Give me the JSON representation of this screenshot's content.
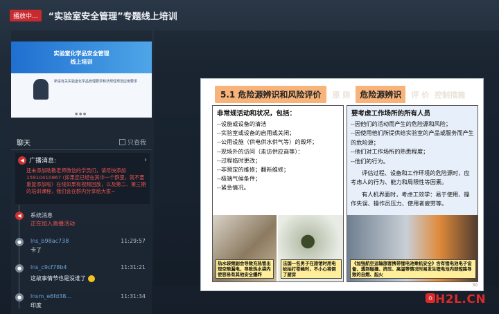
{
  "topbar": {
    "live_badge": "播放中...",
    "title": "“实验室安全管理”专题线上培训"
  },
  "preview": {
    "heading_line1": "实验室化学品安全管理",
    "heading_line2": "线上培训",
    "body_text": "新进有关实验室化学品管理要求和法规性规范应用要求"
  },
  "chat": {
    "title": "聊天",
    "only_view_label": "只查我",
    "broadcast": {
      "title": "广播消息:",
      "text": "还未添加助教老师微信的学员们，请尽快添加15910410867 (如果您已经在其中一个群里，就不要重复添加啦）在线如果有视频回放，以及第二、第三期的培训课程，我们会在群内分享给大家~"
    },
    "messages": [
      {
        "name": "系统消息",
        "time": "",
        "text": "正在加入直播活动",
        "type": "system"
      },
      {
        "name": "lns_b98ac738",
        "time": "11:29:57",
        "text": "卡了",
        "type": "user"
      },
      {
        "name": "lns_c9cf78b4",
        "time": "11:31:21",
        "text": "这故事情节也是没谁了",
        "type": "user"
      },
      {
        "name": "lnsm_e6fd38...",
        "time": "11:31:34",
        "text": "印度",
        "type": "user"
      }
    ]
  },
  "slide": {
    "tab1": "5.1 危险源辨识和风险评价",
    "tab_dim1": "原 则",
    "tab2": "危险源辨识",
    "tab_dim2": "评 价",
    "tab_dim3": "控制措施",
    "left_heading": "非常规活动和状况，包括：",
    "left_items": [
      "--设施或设备的清洁",
      "--实验室或设备的启用或关闭；",
      "--公用设施（供电供水供气等）的毁坏；",
      "--现场外的访问（走访供应商等）：",
      "--过程临时更改；",
      "--非预定的维修；翻新维修；",
      "--极端气候条件；",
      "--紧急情况。"
    ],
    "right_heading": "要考虑工作场所的所有人员",
    "right_items": [
      "--因他们的活动而产生的危险源和风险；",
      "--因使用他们所提供给实验室的产品或服务而产生的危险源；",
      "--他们对工作场所的熟悉程度；",
      "--他们的行为。"
    ],
    "right_para1": "评估过程、设备和工作环境的危险源时，应考虑人的行为、能力和局限性等因素。",
    "right_para2": "有人机界面时，考虑工效学：易于使用、操作失误、操作员压力、使用者疲劳等。",
    "cap1": "热水袋频副会导致充热管出现空隙漏电，导致热水袋内使容易有其他安全爆炸",
    "cap2": "法国一名男子在旅馆时用电蚊拍打苍蝇时，不小心将倒了厨房",
    "cap3": "《加强航空运输旅客携带锂电池乘机安全》含有锂电池电子设备，遇到碰撞、挤压、高温等情况时易发生锂电池内部短路导致的自燃、起火",
    "page_no": "30"
  },
  "watermark": {
    "text": "H2L.CN",
    "icon": "h2l-logo-icon"
  }
}
